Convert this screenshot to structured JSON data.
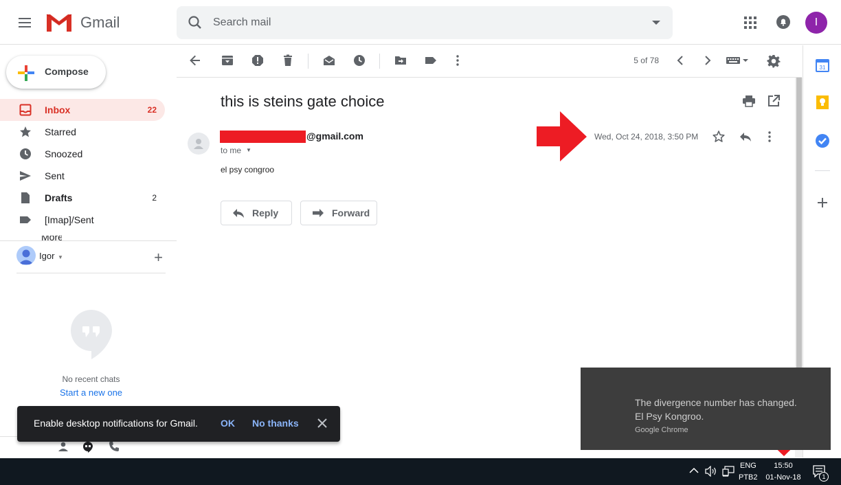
{
  "colors": {
    "inbox_active_bg": "#fce8e6",
    "inbox_active_text": "#d93025",
    "avatar_bg": "#8e24aa",
    "redaction": "#ed1c24",
    "link_blue": "#1a73e8",
    "snackbar_bg": "#202124",
    "toast_bg": "#3d3d3d",
    "taskbar_bg": "#101820"
  },
  "header": {
    "app_name": "Gmail",
    "search_placeholder": "Search mail",
    "avatar_initial": "I",
    "icons": [
      "menu-icon",
      "gmail-logo",
      "search-icon",
      "search-options-icon",
      "apps-grid-icon",
      "notifications-icon"
    ]
  },
  "compose": {
    "label": "Compose"
  },
  "nav": {
    "items": [
      {
        "label": "Inbox",
        "count": "22",
        "icon": "inbox-icon"
      },
      {
        "label": "Starred",
        "count": "",
        "icon": "star-icon"
      },
      {
        "label": "Snoozed",
        "count": "",
        "icon": "clock-icon"
      },
      {
        "label": "Sent",
        "count": "",
        "icon": "send-icon"
      },
      {
        "label": "Drafts",
        "count": "2",
        "icon": "draft-icon"
      },
      {
        "label": "[Imap]/Sent",
        "count": "",
        "icon": "label-icon"
      }
    ],
    "more_clipped": "More"
  },
  "hangouts": {
    "user_name": "Igor",
    "no_chats": "No recent chats",
    "start_new": "Start a new one"
  },
  "toolbar": {
    "pager": "5 of 78",
    "icons": [
      "back-icon",
      "archive-icon",
      "report-spam-icon",
      "delete-icon",
      "mark-unread-icon",
      "snooze-icon",
      "move-to-icon",
      "labels-icon",
      "more-icon",
      "prev-icon",
      "next-icon",
      "input-tools-icon",
      "settings-icon"
    ]
  },
  "message": {
    "subject": "this is steins gate choice",
    "sender_email": "@gmail.com",
    "to": "to me",
    "date": "Wed, Oct 24, 2018, 3:50 PM",
    "body": "el psy congroo",
    "reply_label": "Reply",
    "forward_label": "Forward"
  },
  "snackbar": {
    "text": "Enable desktop notifications for Gmail.",
    "ok": "OK",
    "no_thanks": "No thanks"
  },
  "toast": {
    "line1": "The divergence number has changed.",
    "line2": "El Psy Kongroo.",
    "source": "Google Chrome"
  },
  "taskbar": {
    "lang_top": "ENG",
    "lang_bottom": "PTB2",
    "time": "15:50",
    "date": "01-Nov-18",
    "notification_count": "1"
  }
}
